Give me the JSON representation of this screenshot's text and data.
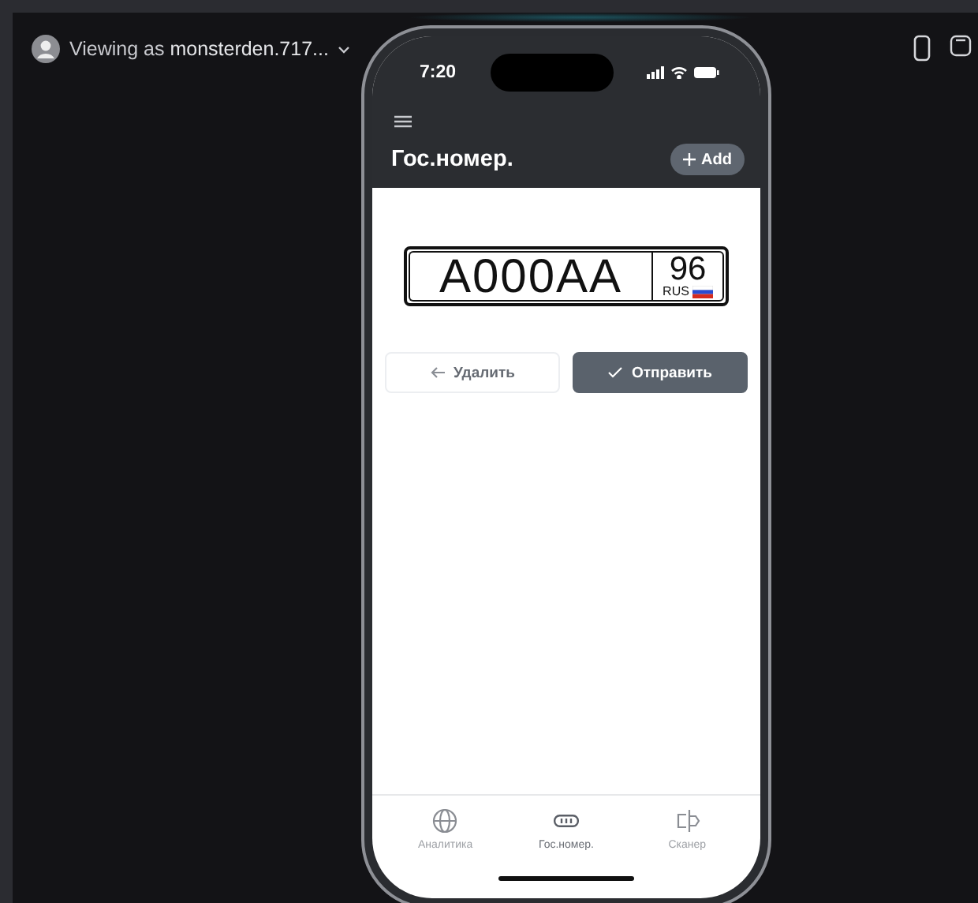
{
  "viewer": {
    "prefix": "Viewing as",
    "user": "monsterden.717..."
  },
  "phone": {
    "time": "7:20",
    "title": "Гос.номер.",
    "add_button": "Add",
    "plate": {
      "number": "А000АА",
      "region": "96",
      "country": "RUS"
    },
    "actions": [
      {
        "kind": "secondary",
        "label": "Удалить"
      },
      {
        "kind": "primary",
        "label": "Отправить"
      }
    ],
    "tabs": [
      {
        "kind": "analytics",
        "label": "Аналитика",
        "selected": false
      },
      {
        "kind": "plate",
        "label": "Гос.номер.",
        "selected": true
      },
      {
        "kind": "scanner",
        "label": "Сканер",
        "selected": false
      }
    ]
  }
}
